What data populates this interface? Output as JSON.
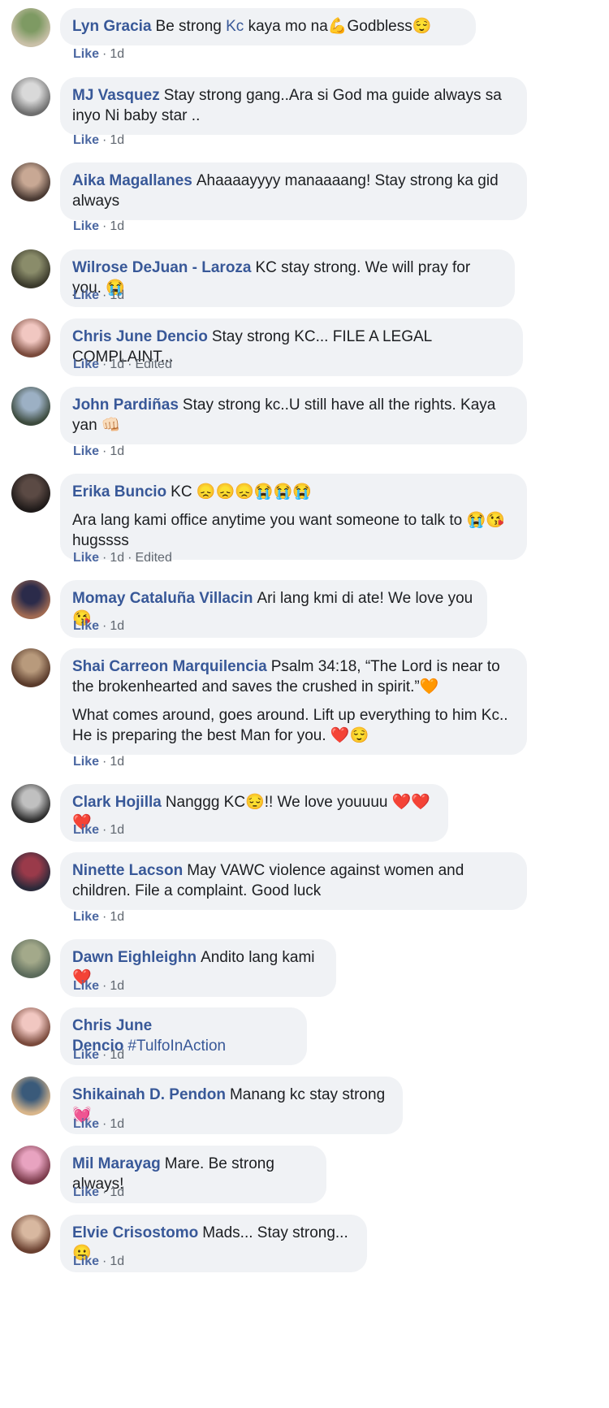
{
  "comments": [
    {
      "author": "Lyn Gracia",
      "parts": [
        {
          "t": "Be strong "
        },
        {
          "t": "Kc",
          "tag": true
        },
        {
          "t": " kaya mo na💪Godbless😌"
        }
      ],
      "extra": "",
      "like": "Like",
      "time": "1d",
      "edited": "",
      "avatar_colors": [
        "#7e9a63",
        "#c9c0a8"
      ]
    },
    {
      "author": "MJ Vasquez",
      "parts": [
        {
          "t": "Stay strong gang..Ara si God ma guide always sa inyo Ni baby star .."
        }
      ],
      "extra": "",
      "like": "Like",
      "time": "1d",
      "edited": "",
      "avatar_colors": [
        "#d9d9d9",
        "#6e6e6e"
      ]
    },
    {
      "author": "Aika Magallanes",
      "parts": [
        {
          "t": "Ahaaaayyyy manaaaang! Stay strong ka gid always"
        }
      ],
      "extra": "",
      "like": "Like",
      "time": "1d",
      "edited": "",
      "avatar_colors": [
        "#c8a894",
        "#4a3a33"
      ]
    },
    {
      "author": "Wilrose DeJuan - Laroza",
      "parts": [
        {
          "t": "KC stay strong. We will pray for you. 😭"
        }
      ],
      "extra": "",
      "like": "Like",
      "time": "1d",
      "edited": "",
      "avatar_colors": [
        "#8a8c6a",
        "#3b3a2c"
      ]
    },
    {
      "author": "Chris June Dencio",
      "parts": [
        {
          "t": "Stay strong KC... FILE A LEGAL COMPLAINT..."
        }
      ],
      "extra": "",
      "like": "Like",
      "time": "1d",
      "edited": "Edited",
      "avatar_colors": [
        "#f1c7c1",
        "#7a4a3c"
      ]
    },
    {
      "author": "John Pardiñas",
      "parts": [
        {
          "t": "Stay strong kc..U still have all the rights. Kaya yan 👊🏻"
        }
      ],
      "extra": "",
      "like": "Like",
      "time": "1d",
      "edited": "",
      "avatar_colors": [
        "#9cb0c4",
        "#3c4a3d"
      ]
    },
    {
      "author": "Erika Buncio",
      "parts": [
        {
          "t": "KC 😞😞😞😭😭😭"
        }
      ],
      "extra": "Ara lang kami office anytime you want someone to talk to 😭😘 hugssss",
      "like": "Like",
      "time": "1d",
      "edited": "Edited",
      "avatar_colors": [
        "#5b4a44",
        "#1f1a19"
      ]
    },
    {
      "author": "Momay Cataluña Villacin",
      "parts": [
        {
          "t": "Ari lang kmi di ate! We love you 😘"
        }
      ],
      "extra": "",
      "like": "Like",
      "time": "1d",
      "edited": "",
      "avatar_colors": [
        "#2b2b4a",
        "#a06a52"
      ]
    },
    {
      "author": "Shai Carreon Marquilencia",
      "parts": [
        {
          "t": "Psalm 34:18, “The Lord is near to the brokenhearted and saves the crushed in spirit.”🧡"
        }
      ],
      "extra": "What comes around, goes around. Lift up everything to him Kc.. He is preparing the best Man for you. ❤️😌",
      "like": "Like",
      "time": "1d",
      "edited": "",
      "avatar_colors": [
        "#b89a7c",
        "#5a3b2b"
      ]
    },
    {
      "author": "Clark Hojilla",
      "parts": [
        {
          "t": "Nanggg KC😔!! We love youuuu ❤️❤️❤️"
        }
      ],
      "extra": "",
      "like": "Like",
      "time": "1d",
      "edited": "",
      "avatar_colors": [
        "#c0c0c0",
        "#2e2e2e"
      ]
    },
    {
      "author": "Ninette Lacson",
      "parts": [
        {
          "t": "May VAWC violence against women and children. File a complaint. Good luck"
        }
      ],
      "extra": "",
      "like": "Like",
      "time": "1d",
      "edited": "",
      "avatar_colors": [
        "#9a3a4a",
        "#2b2a3a"
      ]
    },
    {
      "author": "Dawn Eighleighn",
      "parts": [
        {
          "t": "Andito lang kami ❤️"
        }
      ],
      "extra": "",
      "like": "Like",
      "time": "1d",
      "edited": "",
      "avatar_colors": [
        "#a3a98a",
        "#5b6a5a"
      ]
    },
    {
      "author": "Chris June Dencio",
      "parts": [
        {
          "t": "#TulfoInAction",
          "tag": true
        }
      ],
      "extra": "",
      "like": "Like",
      "time": "1d",
      "edited": "",
      "avatar_colors": [
        "#f1c7c1",
        "#7a4a3c"
      ]
    },
    {
      "author": "Shikainah D. Pendon",
      "parts": [
        {
          "t": "Manang kc stay strong 💓"
        }
      ],
      "extra": "",
      "like": "Like",
      "time": "1d",
      "edited": "",
      "avatar_colors": [
        "#3a5a7a",
        "#d8b58a"
      ]
    },
    {
      "author": "Mil Marayag",
      "parts": [
        {
          "t": "Mare. Be strong always!"
        }
      ],
      "extra": "",
      "like": "Like",
      "time": "1d",
      "edited": "",
      "avatar_colors": [
        "#e8a3c0",
        "#7a3a4a"
      ]
    },
    {
      "author": "Elvie Crisostomo",
      "parts": [
        {
          "t": "Mads... Stay strong... 😐"
        }
      ],
      "extra": "",
      "like": "Like",
      "time": "1d",
      "edited": "",
      "avatar_colors": [
        "#d8b8a0",
        "#6a4030"
      ]
    }
  ]
}
